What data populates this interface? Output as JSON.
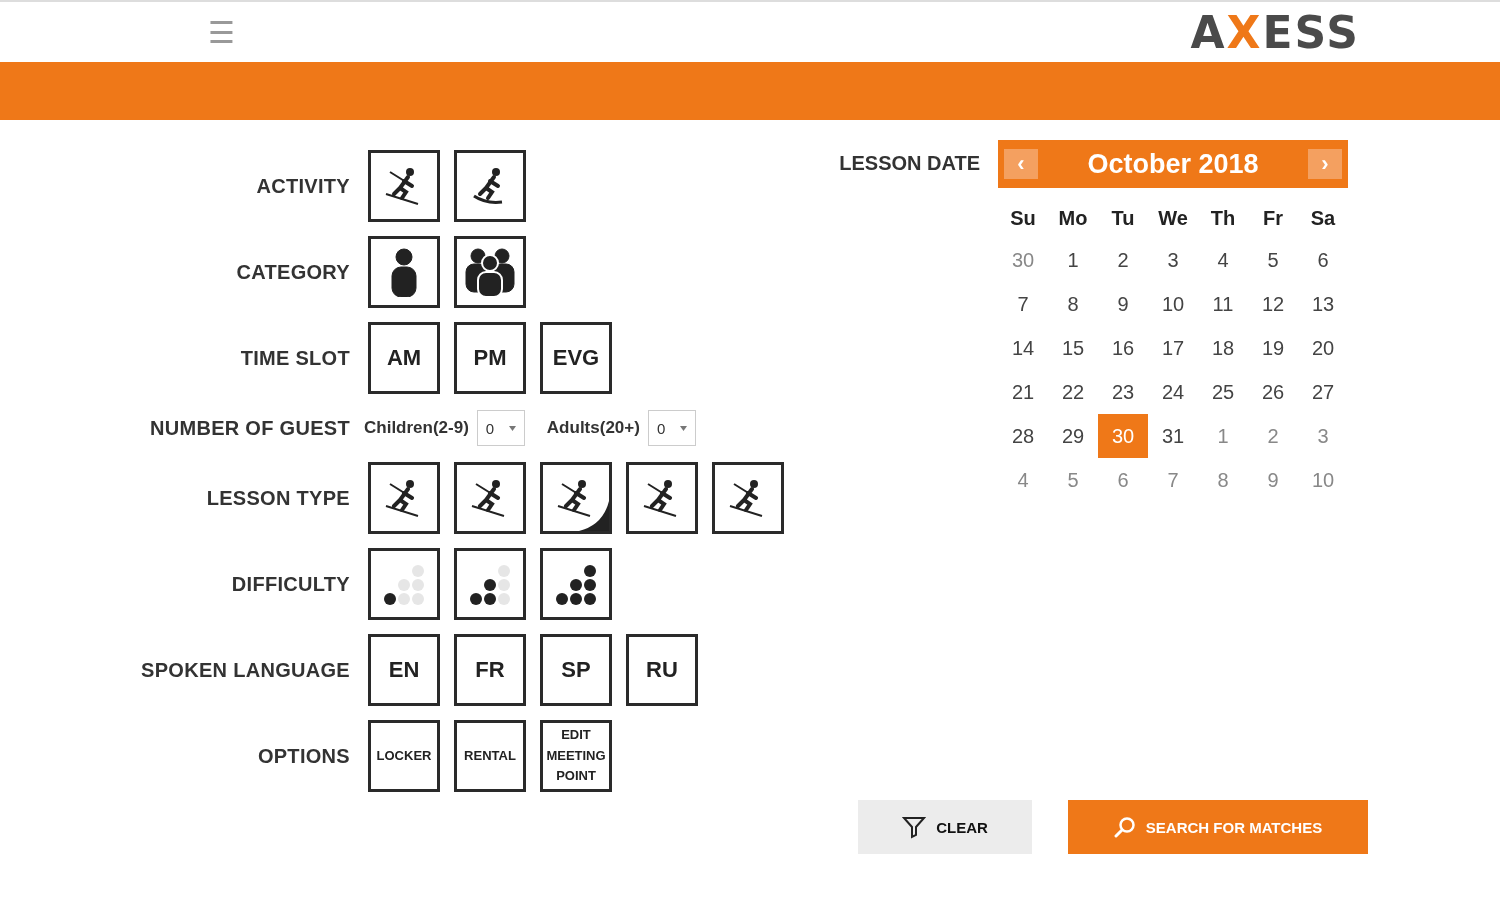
{
  "header": {
    "menu": "☰",
    "logo": "AXESS"
  },
  "form": [
    {
      "kind": "tiles",
      "label": "ACTIVITY",
      "tiles": [
        {
          "kind": "ski"
        },
        {
          "kind": "snowboard"
        }
      ]
    },
    {
      "kind": "tiles",
      "label": "CATEGORY",
      "tiles": [
        {
          "kind": "person"
        },
        {
          "kind": "group"
        }
      ]
    },
    {
      "kind": "tiles",
      "label": "TIME SLOT",
      "tiles": [
        {
          "kind": "text",
          "text": "AM"
        },
        {
          "kind": "text",
          "text": "PM"
        },
        {
          "kind": "text",
          "text": "EVG"
        }
      ]
    },
    {
      "kind": "guests",
      "label": "NUMBER OF GUEST",
      "selects": [
        {
          "label": "Children(2-9)",
          "value": "0"
        },
        {
          "label": "Adults(20+)",
          "value": "0"
        }
      ]
    },
    {
      "kind": "tiles",
      "label": "LESSON TYPE",
      "tiles": [
        {
          "kind": "ski"
        },
        {
          "kind": "touring"
        },
        {
          "kind": "freestyle"
        },
        {
          "kind": "telemark"
        },
        {
          "kind": "sitski"
        }
      ]
    },
    {
      "kind": "tiles",
      "label": "DIFFICULTY",
      "tiles": [
        {
          "kind": "dots1"
        },
        {
          "kind": "dots2"
        },
        {
          "kind": "dots3"
        }
      ]
    },
    {
      "kind": "tiles",
      "label": "SPOKEN LANGUAGE",
      "tiles": [
        {
          "kind": "text",
          "text": "EN"
        },
        {
          "kind": "text",
          "text": "FR"
        },
        {
          "kind": "text",
          "text": "SP"
        },
        {
          "kind": "text",
          "text": "RU"
        }
      ]
    },
    {
      "kind": "tiles",
      "label": "OPTIONS",
      "tiles": [
        {
          "kind": "small",
          "text": "LOCKER"
        },
        {
          "kind": "small",
          "text": "RENTAL"
        },
        {
          "kind": "small",
          "text": "EDIT MEETING POINT"
        }
      ]
    }
  ],
  "lesson_date": {
    "label": "LESSON DATE",
    "prev": "‹",
    "next": "›",
    "month": "October 2018",
    "weekdays": [
      "Su",
      "Mo",
      "Tu",
      "We",
      "Th",
      "Fr",
      "Sa"
    ],
    "weeks": [
      [
        {
          "d": "30",
          "muted": true,
          "selected": false
        },
        {
          "d": "1",
          "muted": false,
          "selected": false
        },
        {
          "d": "2",
          "muted": false,
          "selected": false
        },
        {
          "d": "3",
          "muted": false,
          "selected": false
        },
        {
          "d": "4",
          "muted": false,
          "selected": false
        },
        {
          "d": "5",
          "muted": false,
          "selected": false
        },
        {
          "d": "6",
          "muted": false,
          "selected": false
        }
      ],
      [
        {
          "d": "7",
          "muted": false,
          "selected": false
        },
        {
          "d": "8",
          "muted": false,
          "selected": false
        },
        {
          "d": "9",
          "muted": false,
          "selected": false
        },
        {
          "d": "10",
          "muted": false,
          "selected": false
        },
        {
          "d": "11",
          "muted": false,
          "selected": false
        },
        {
          "d": "12",
          "muted": false,
          "selected": false
        },
        {
          "d": "13",
          "muted": false,
          "selected": false
        }
      ],
      [
        {
          "d": "14",
          "muted": false,
          "selected": false
        },
        {
          "d": "15",
          "muted": false,
          "selected": false
        },
        {
          "d": "16",
          "muted": false,
          "selected": false
        },
        {
          "d": "17",
          "muted": false,
          "selected": false
        },
        {
          "d": "18",
          "muted": false,
          "selected": false
        },
        {
          "d": "19",
          "muted": false,
          "selected": false
        },
        {
          "d": "20",
          "muted": false,
          "selected": false
        }
      ],
      [
        {
          "d": "21",
          "muted": false,
          "selected": false
        },
        {
          "d": "22",
          "muted": false,
          "selected": false
        },
        {
          "d": "23",
          "muted": false,
          "selected": false
        },
        {
          "d": "24",
          "muted": false,
          "selected": false
        },
        {
          "d": "25",
          "muted": false,
          "selected": false
        },
        {
          "d": "26",
          "muted": false,
          "selected": false
        },
        {
          "d": "27",
          "muted": false,
          "selected": false
        }
      ],
      [
        {
          "d": "28",
          "muted": false,
          "selected": false
        },
        {
          "d": "29",
          "muted": false,
          "selected": false
        },
        {
          "d": "30",
          "muted": false,
          "selected": true
        },
        {
          "d": "31",
          "muted": false,
          "selected": false
        },
        {
          "d": "1",
          "muted": true,
          "selected": false
        },
        {
          "d": "2",
          "muted": true,
          "selected": false
        },
        {
          "d": "3",
          "muted": true,
          "selected": false
        }
      ],
      [
        {
          "d": "4",
          "muted": true,
          "selected": false
        },
        {
          "d": "5",
          "muted": true,
          "selected": false
        },
        {
          "d": "6",
          "muted": true,
          "selected": false
        },
        {
          "d": "7",
          "muted": true,
          "selected": false
        },
        {
          "d": "8",
          "muted": true,
          "selected": false
        },
        {
          "d": "9",
          "muted": true,
          "selected": false
        },
        {
          "d": "10",
          "muted": true,
          "selected": false
        }
      ]
    ]
  },
  "actions": {
    "clear": "CLEAR",
    "search": "SEARCH FOR MATCHES"
  }
}
